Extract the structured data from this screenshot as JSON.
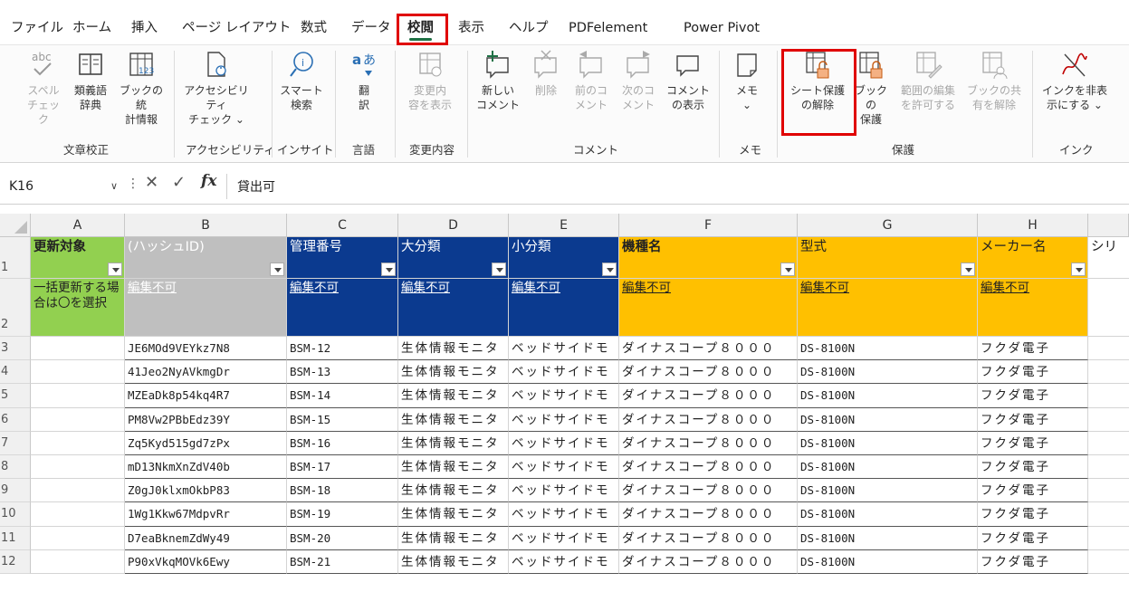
{
  "menu": {
    "items": [
      "ファイル",
      "ホーム",
      "挿入",
      "ページ レイアウト",
      "数式",
      "データ",
      "校閲",
      "表示",
      "ヘルプ",
      "PDFelement",
      "Power Pivot"
    ],
    "active_index": 6
  },
  "ribbon": {
    "buttons": [
      {
        "label": "スペル\nチェック",
        "icon": "spell-check-icon",
        "disabled": true
      },
      {
        "label": "類義語\n辞典",
        "icon": "thesaurus-icon",
        "disabled": false
      },
      {
        "label": "ブックの統\n計情報",
        "icon": "workbook-stats-icon",
        "disabled": false
      },
      {
        "label": "アクセシビリティ\nチェック ⌄",
        "icon": "accessibility-icon",
        "disabled": false
      },
      {
        "label": "スマート\n検索",
        "icon": "smart-lookup-icon",
        "disabled": false
      },
      {
        "label": "翻\n訳",
        "icon": "translate-icon",
        "disabled": false
      },
      {
        "label": "変更内\n容を表示",
        "icon": "show-changes-icon",
        "disabled": true
      },
      {
        "label": "新しい\nコメント",
        "icon": "new-comment-icon",
        "disabled": false
      },
      {
        "label": "削除",
        "icon": "delete-comment-icon",
        "disabled": true
      },
      {
        "label": "前のコ\nメント",
        "icon": "previous-comment-icon",
        "disabled": true
      },
      {
        "label": "次のコ\nメント",
        "icon": "next-comment-icon",
        "disabled": true
      },
      {
        "label": "コメント\nの表示",
        "icon": "show-comments-icon",
        "disabled": false
      },
      {
        "label": "メモ\n⌄",
        "icon": "notes-icon",
        "disabled": false
      },
      {
        "label": "シート保護\nの解除",
        "icon": "unprotect-sheet-icon",
        "disabled": false
      },
      {
        "label": "ブックの\n保護",
        "icon": "protect-workbook-icon",
        "disabled": false
      },
      {
        "label": "範囲の編集\nを許可する",
        "icon": "allow-edit-ranges-icon",
        "disabled": true
      },
      {
        "label": "ブックの共\n有を解除",
        "icon": "unshare-workbook-icon",
        "disabled": true
      },
      {
        "label": "インクを非表\n示にする ⌄",
        "icon": "hide-ink-icon",
        "disabled": false
      }
    ],
    "groups": [
      "文章校正",
      "アクセシビリティ",
      "インサイト",
      "言語",
      "変更内容",
      "コメント",
      "メモ",
      "保護",
      "インク"
    ]
  },
  "formula_bar": {
    "name_box": "K16",
    "formula": "貸出可"
  },
  "sheet": {
    "columns": [
      "A",
      "B",
      "C",
      "D",
      "E",
      "F",
      "G",
      "H"
    ],
    "headers": [
      "更新対象",
      "(ハッシュID)",
      "管理番号",
      "大分類",
      "小分類",
      "機種名",
      "型式",
      "メーカー名"
    ],
    "overflow_header": "シリ",
    "row2_note": "一括更新する場合は〇を選択",
    "row2_label": "編集不可",
    "row_numbers": [
      "1",
      "2",
      "3",
      "4",
      "5",
      "6",
      "7",
      "8",
      "9",
      "10",
      "11",
      "12"
    ],
    "rows": [
      {
        "b": "JE6MOd9VEYkz7N8",
        "c": "BSM-12",
        "d": "生体情報モニタ",
        "e": "ベッドサイドモ",
        "f": "ダイナスコープ８０００",
        "g": "DS-8100N",
        "h": "フクダ電子"
      },
      {
        "b": "41Jeo2NyAVkmgDr",
        "c": "BSM-13",
        "d": "生体情報モニタ",
        "e": "ベッドサイドモ",
        "f": "ダイナスコープ８０００",
        "g": "DS-8100N",
        "h": "フクダ電子"
      },
      {
        "b": "MZEaDk8p54kq4R7",
        "c": "BSM-14",
        "d": "生体情報モニタ",
        "e": "ベッドサイドモ",
        "f": "ダイナスコープ８０００",
        "g": "DS-8100N",
        "h": "フクダ電子"
      },
      {
        "b": "PM8Vw2PBbEdz39Y",
        "c": "BSM-15",
        "d": "生体情報モニタ",
        "e": "ベッドサイドモ",
        "f": "ダイナスコープ８０００",
        "g": "DS-8100N",
        "h": "フクダ電子"
      },
      {
        "b": "Zq5Kyd515gd7zPx",
        "c": "BSM-16",
        "d": "生体情報モニタ",
        "e": "ベッドサイドモ",
        "f": "ダイナスコープ８０００",
        "g": "DS-8100N",
        "h": "フクダ電子"
      },
      {
        "b": "mD13NkmXnZdV40b",
        "c": "BSM-17",
        "d": "生体情報モニタ",
        "e": "ベッドサイドモ",
        "f": "ダイナスコープ８０００",
        "g": "DS-8100N",
        "h": "フクダ電子"
      },
      {
        "b": "Z0gJ0klxmOkbP83",
        "c": "BSM-18",
        "d": "生体情報モニタ",
        "e": "ベッドサイドモ",
        "f": "ダイナスコープ８０００",
        "g": "DS-8100N",
        "h": "フクダ電子"
      },
      {
        "b": "1Wg1Kkw67MdpvRr",
        "c": "BSM-19",
        "d": "生体情報モニタ",
        "e": "ベッドサイドモ",
        "f": "ダイナスコープ８０００",
        "g": "DS-8100N",
        "h": "フクダ電子"
      },
      {
        "b": "D7eaBknemZdWy49",
        "c": "BSM-20",
        "d": "生体情報モニタ",
        "e": "ベッドサイドモ",
        "f": "ダイナスコープ８０００",
        "g": "DS-8100N",
        "h": "フクダ電子"
      },
      {
        "b": "P90xVkqMOVk6Ewy",
        "c": "BSM-21",
        "d": "生体情報モニタ",
        "e": "ベッドサイドモ",
        "f": "ダイナスコープ８０００",
        "g": "DS-8100N",
        "h": "フクダ電子"
      }
    ]
  },
  "colors": {
    "green": "#92d050",
    "gray": "#bfbfbf",
    "navy": "#0b3a8f",
    "orange": "#ffc000",
    "highlight": "#e00000",
    "accent": "#1e7145"
  }
}
